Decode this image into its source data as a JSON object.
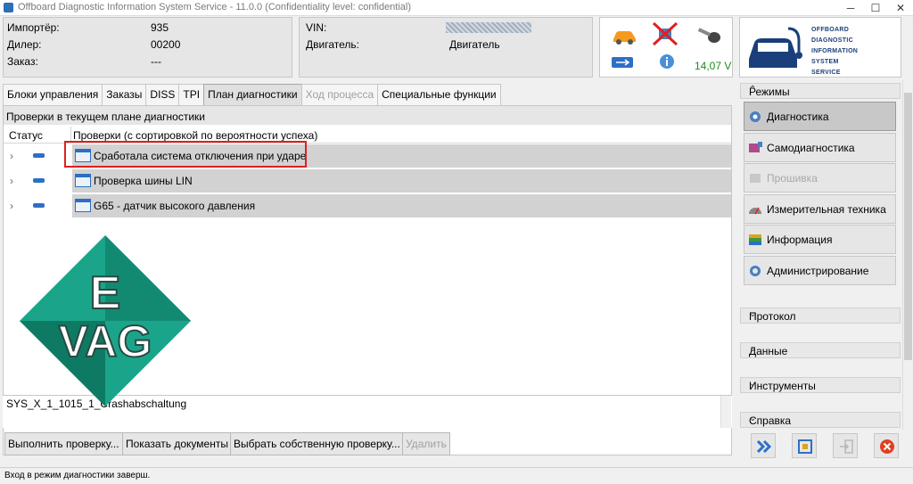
{
  "window": {
    "title": "Offboard Diagnostic Information System Service - 11.0.0 (Confidentiality level: confidential)",
    "minimize": "─",
    "maximize": "☐",
    "close": "✕"
  },
  "header": {
    "importer_label": "Импортёр:",
    "importer_value": "935",
    "dealer_label": "Дилер:",
    "dealer_value": "00200",
    "order_label": "Заказ:",
    "order_value": "---",
    "vin_label": "VIN:",
    "engine_label": "Двигатель:",
    "engine_value": "Двигатель",
    "voltage": "14,07 V",
    "icons": [
      "car-icon",
      "diagnostic-connection-disabled-icon",
      "ignition-key-icon",
      "usb-icon",
      "info-icon"
    ]
  },
  "logo": {
    "lines": [
      "OFFBOARD",
      "DIAGNOSTIC",
      "INFORMATION",
      "SYSTEM",
      "SERVICE"
    ]
  },
  "tabs": [
    {
      "label": "Блоки управления",
      "state": "normal"
    },
    {
      "label": "Заказы",
      "state": "normal"
    },
    {
      "label": "DISS",
      "state": "normal"
    },
    {
      "label": "TPI",
      "state": "normal"
    },
    {
      "label": "План диагностики",
      "state": "active"
    },
    {
      "label": "Ход процесса",
      "state": "disabled"
    },
    {
      "label": "Специальные функции",
      "state": "normal"
    }
  ],
  "plan": {
    "heading": "Проверки в текущем плане диагностики",
    "col_status": "Статус",
    "col_checks": "Проверки (с сортировкой по вероятности успеха)",
    "rows": [
      {
        "label": "Сработала система отключения при ударе"
      },
      {
        "label": "Проверка шины LIN"
      },
      {
        "label": "G65 - датчик высокого давления"
      }
    ],
    "detail_text": "SYS_X_1_1015_1_Crashabschaltung"
  },
  "watermark": {
    "line1": "E",
    "line2": "VAG"
  },
  "actions": {
    "run": "Выполнить проверку...",
    "docs": "Показать документы",
    "choose": "Выбрать собственную проверку...",
    "delete": "Удалить"
  },
  "statusbar": {
    "text": "Вход в режим диагностики заверш."
  },
  "sidebar": {
    "modes_title": "Режимы",
    "modes": [
      {
        "label": "Диагностика",
        "state": "active"
      },
      {
        "label": "Самодиагностика",
        "state": "normal"
      },
      {
        "label": "Прошивка",
        "state": "disabled"
      },
      {
        "label": "Измерительная техника",
        "state": "normal"
      },
      {
        "label": "Информация",
        "state": "normal"
      },
      {
        "label": "Администрирование",
        "state": "normal"
      }
    ],
    "protocol_title": "Протокол",
    "data_title": "Данные",
    "tools_title": "Инструменты",
    "help_title": "Справка"
  },
  "colors": {
    "highlight": "#e02020",
    "watermark_green": "#1aa58a",
    "voltage": "#1a8f1a"
  }
}
